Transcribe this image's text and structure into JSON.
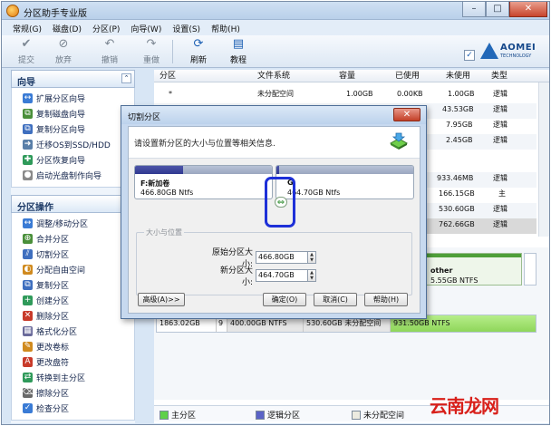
{
  "app": {
    "title": "分区助手专业版"
  },
  "window_buttons": {
    "minimize": "–",
    "maximize": "□",
    "close": "✕"
  },
  "menu": [
    "常规(G)",
    "磁盘(D)",
    "分区(P)",
    "向导(W)",
    "设置(S)",
    "帮助(H)"
  ],
  "toolbar": {
    "commit": "提交",
    "discard": "放弃",
    "undo": "撤销",
    "redo": "重做",
    "refresh": "刷新",
    "tutorial": "教程",
    "logo": "AOMEI",
    "logo_sub": "TECHNOLOGY"
  },
  "icons": {
    "commit": "check-icon",
    "discard": "discard-icon",
    "undo": "undo-icon",
    "redo": "redo-icon",
    "refresh": "refresh-icon",
    "tutorial": "tutorial-icon"
  },
  "sidebar": {
    "wizard": {
      "title": "向导",
      "items": [
        "扩展分区向导",
        "复制磁盘向导",
        "复制分区向导",
        "迁移OS到SSD/HDD",
        "分区恢复向导",
        "启动光盘制作向导"
      ]
    },
    "ops": {
      "title": "分区操作",
      "items": [
        "调整/移动分区",
        "合并分区",
        "切割分区",
        "分配自由空间",
        "复制分区",
        "创建分区",
        "删除分区",
        "格式化分区",
        "更改卷标",
        "更改盘符",
        "转换到主分区",
        "擦除分区",
        "检查分区"
      ]
    }
  },
  "grid": {
    "headers": [
      "分区",
      "文件系统",
      "容量",
      "已使用",
      "未使用",
      "类型"
    ],
    "rows": [
      [
        "*",
        "未分配空间",
        "1.00GB",
        "0.00KB",
        "1.00GB",
        "逻辑"
      ],
      [
        "",
        "",
        "",
        "",
        "43.53GB",
        "逻辑"
      ],
      [
        "",
        "",
        "",
        "",
        "7.95GB",
        "逻辑"
      ],
      [
        "",
        "",
        "",
        "",
        "2.45GB",
        "逻辑"
      ],
      [
        "",
        "",
        "",
        "",
        "",
        ""
      ],
      [
        "",
        "",
        "",
        "",
        "933.46MB",
        "逻辑"
      ],
      [
        "",
        "",
        "",
        "",
        "166.15GB",
        "主"
      ],
      [
        "",
        "",
        "",
        "",
        "530.60GB",
        "逻辑"
      ],
      [
        "",
        "",
        "",
        "",
        "762.66GB",
        "逻辑"
      ]
    ]
  },
  "disk": {
    "other_label": "other",
    "other_fs": "5.55GB NTFS",
    "size": "1863.02GB",
    "index": "9",
    "seg1": "400.00GB NTFS",
    "seg2": "530.60GB 未分配空间",
    "seg3": "931.50GB NTFS"
  },
  "legend": {
    "primary": "主分区",
    "logical": "逻辑分区",
    "unallocated": "未分配空间"
  },
  "colors": {
    "primary": "#5fd04a",
    "logical": "#5a63c7",
    "unallocated": "#ecebe0"
  },
  "dialog": {
    "title": "切割分区",
    "close": "✕",
    "prompt": "请设置新分区的大小与位置等相关信息.",
    "left": {
      "name": "F:新加卷",
      "info": "466.80GB Ntfs",
      "used_fraction": 0.35
    },
    "right": {
      "name": "G",
      "info": "464.70GB Ntfs",
      "used_fraction": 0.02
    },
    "group_title": "大小与位置",
    "orig_label": "原始分区大小:",
    "orig_value": "466.80GB",
    "new_label": "新分区大小:",
    "new_value": "464.70GB",
    "advanced": "高级(A)>>",
    "ok": "确定(O)",
    "cancel": "取消(C)",
    "help": "帮助(H)"
  },
  "watermark": "云南龙网"
}
